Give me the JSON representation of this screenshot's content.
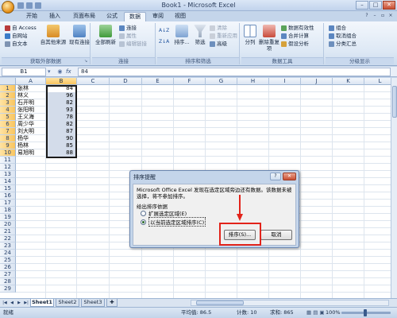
{
  "window": {
    "title": "Book1 - Microsoft Excel",
    "controls": [
      "–",
      "□",
      "✕"
    ]
  },
  "tabs": [
    "开始",
    "插入",
    "页面布局",
    "公式",
    "数据",
    "审阅",
    "视图"
  ],
  "active_tab": "数据",
  "ribbon": {
    "external_data": {
      "label": "获取外部数据",
      "access": "自 Access",
      "web": "自网站",
      "text": "自文本",
      "other": "自其他来源",
      "existing": "现有连接"
    },
    "connections": {
      "label": "连接",
      "refresh_all": "全部刷新",
      "connections": "连接",
      "properties": "属性",
      "edit_links": "编辑链接"
    },
    "sort_filter": {
      "label": "排序和筛选",
      "sort": "排序...",
      "filter": "筛选",
      "clear": "清除",
      "reapply": "重新应用",
      "advanced": "高级"
    },
    "data_tools": {
      "label": "数据工具",
      "text_to_columns": "分列",
      "remove_duplicates": "删除重复项",
      "validation": "数据有效性",
      "consolidate": "合并计算",
      "whatif": "假设分析"
    },
    "outline": {
      "label": "分级显示",
      "group": "组合",
      "ungroup": "取消组合",
      "subtotal": "分类汇总"
    }
  },
  "formula_bar": {
    "name_box": "B1",
    "fx": "fx",
    "value": "84"
  },
  "columns": [
    "A",
    "B",
    "C",
    "D",
    "E",
    "F",
    "G",
    "H",
    "I",
    "J",
    "K",
    "L"
  ],
  "rows": [
    "1",
    "2",
    "3",
    "4",
    "5",
    "6",
    "7",
    "8",
    "9",
    "10",
    "11",
    "12",
    "13",
    "14",
    "15",
    "16",
    "17",
    "18",
    "19",
    "20",
    "21",
    "22",
    "23",
    "24",
    "25",
    "26",
    "27",
    "28",
    "29"
  ],
  "cells": [
    {
      "name": "张林",
      "score": "84"
    },
    {
      "name": "林义",
      "score": "96"
    },
    {
      "name": "石开明",
      "score": "82"
    },
    {
      "name": "张阳明",
      "score": "93"
    },
    {
      "name": "王义海",
      "score": "78"
    },
    {
      "name": "周少华",
      "score": "82"
    },
    {
      "name": "刘大明",
      "score": "87"
    },
    {
      "name": "杨华",
      "score": "90"
    },
    {
      "name": "杨林",
      "score": "85"
    },
    {
      "name": "易旭明",
      "score": "88"
    }
  ],
  "sheets": [
    "Sheet1",
    "Sheet2",
    "Sheet3"
  ],
  "active_sheet": "Sheet1",
  "status": {
    "ready": "就绪",
    "average": "平均值: 86.5",
    "count": "计数: 10",
    "sum": "求和: 865",
    "zoom": "100%"
  },
  "dialog": {
    "title": "排序提醒",
    "help": "?",
    "close": "✕",
    "message": "Microsoft Office Excel 发现在选定区域旁边还有数据。该数据未被选择，将不参加排序。",
    "question": "给出排序依据",
    "option_expand": "扩展选定区域(E)",
    "option_current": "以当前选定区域排序(C)",
    "selected_option": "以当前选定区域排序(C)",
    "sort_button": "排序(S)...",
    "cancel_button": "取消"
  },
  "colors": {
    "accent": "#e2231a",
    "ribbon_bg": "#dde8f5",
    "selection": "#d3dcea"
  }
}
